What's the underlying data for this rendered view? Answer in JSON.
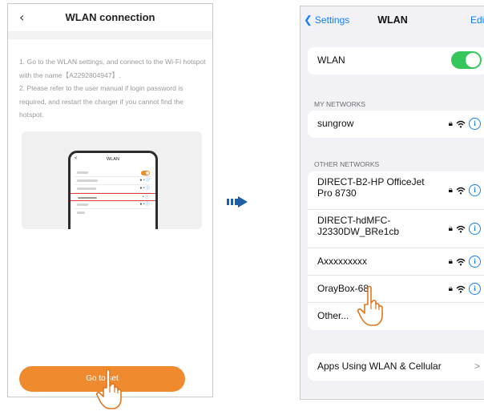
{
  "left": {
    "title": "WLAN connection",
    "back_icon": "chevron-left-icon",
    "instruction_1": "1. Go to the WLAN settings, and connect to the Wi-Fi hotspot with the name【A2292804947】.",
    "instruction_2": "2. Please refer to the user manual if login password is required, and restart the charger if you cannot find the hotspot.",
    "illustration": {
      "title": "WLAN",
      "accent": "#ef8a2e",
      "highlight": "#e23c3c"
    },
    "button_label": "Go to set",
    "button_color": "#ef8a2e"
  },
  "right": {
    "back_label": "Settings",
    "title": "WLAN",
    "edit_label": "Edit",
    "wlan_label": "WLAN",
    "wlan_on": true,
    "my_networks_header": "MY NETWORKS",
    "my_networks": [
      {
        "name": "sungrow",
        "secured": true
      }
    ],
    "other_networks_header": "OTHER NETWORKS",
    "other_networks": [
      {
        "name": "DIRECT-B2-HP OfficeJet Pro 8730",
        "secured": true
      },
      {
        "name": "DIRECT-hdMFC-J2330DW_BRe1cb",
        "secured": true
      },
      {
        "name": "Axxxxxxxxx",
        "secured": true
      },
      {
        "name": "OrayBox-68",
        "secured": true
      }
    ],
    "other_label": "Other...",
    "apps_label": "Apps Using WLAN & Cellular",
    "accent": "#147ef5",
    "toggle_color": "#35c759"
  }
}
